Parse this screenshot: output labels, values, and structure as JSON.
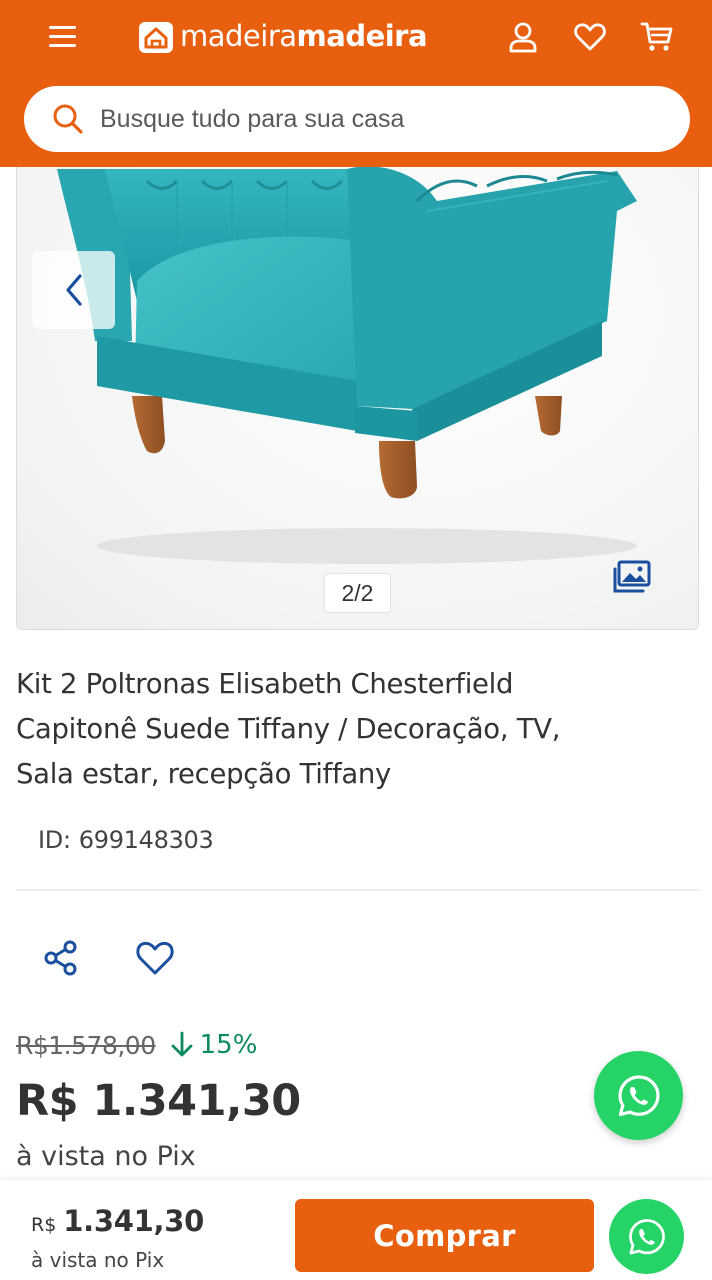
{
  "header": {
    "brand_light": "madeira",
    "brand_bold": "madeira",
    "icons": [
      "menu-icon",
      "account-icon",
      "heart-icon",
      "cart-icon"
    ],
    "color": "#e8600f"
  },
  "search": {
    "placeholder": "Busque tudo para sua casa"
  },
  "gallery": {
    "counter": "2/2"
  },
  "product": {
    "title": "Kit 2 Poltronas Elisabeth Chesterfield Capitonê Suede Tiffany / Decoração, TV, Sala estar, recepção Tiffany",
    "id_label": "ID:",
    "id_value": "699148303"
  },
  "pricing": {
    "old_price": "R$1.578,00",
    "discount": "15%",
    "price": "R$ 1.341,30",
    "payment_note": "à vista no Pix",
    "discount_color": "#0e8a5f"
  },
  "bottom_bar": {
    "currency": "R$",
    "amount": "1.341,30",
    "note": "à vista no Pix",
    "buy_label": "Comprar"
  },
  "colors": {
    "brand": "#e8600f",
    "whatsapp": "#25d366",
    "link_blue": "#1a4fa0"
  }
}
